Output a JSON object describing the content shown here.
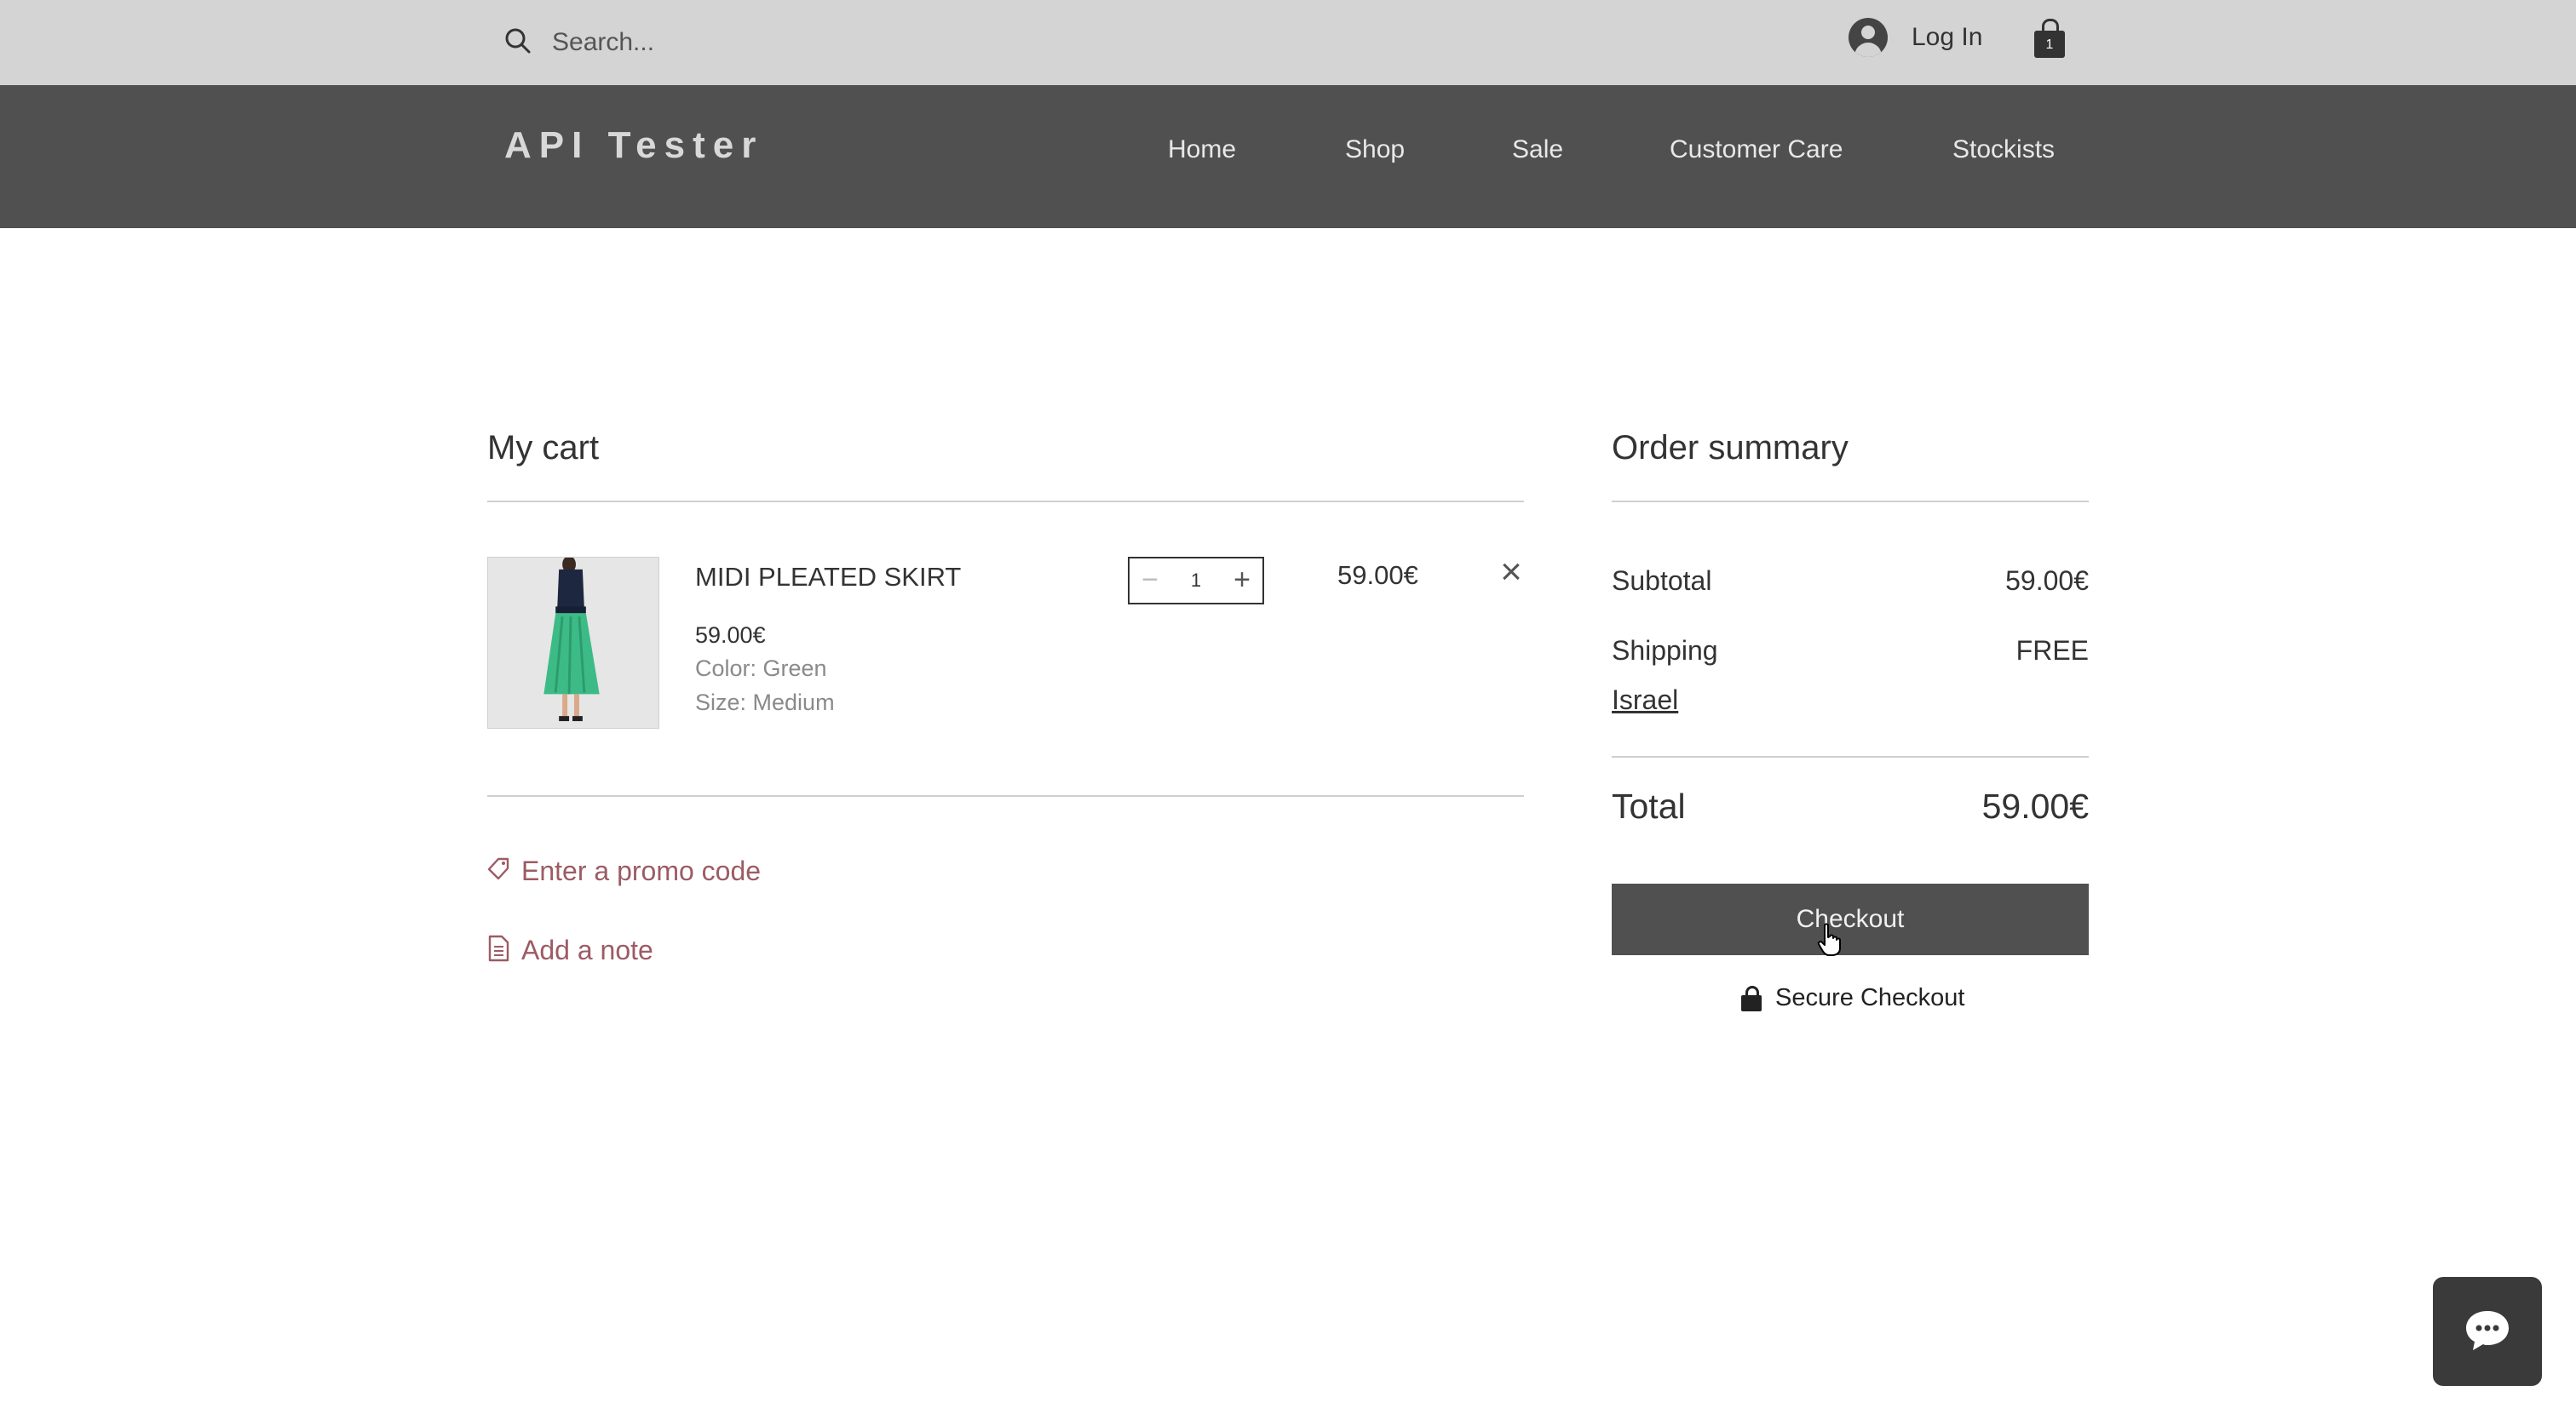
{
  "topbar": {
    "search_placeholder": "Search...",
    "login_label": "Log In",
    "cart_count": "1"
  },
  "header": {
    "brand": "API Tester",
    "nav": [
      {
        "label": "Home"
      },
      {
        "label": "Shop"
      },
      {
        "label": "Sale"
      },
      {
        "label": "Customer Care"
      },
      {
        "label": "Stockists"
      }
    ]
  },
  "cart": {
    "title": "My cart",
    "items": [
      {
        "name": "MIDI PLEATED SKIRT",
        "price": "59.00€",
        "color": "Color: Green",
        "size": "Size: Medium",
        "quantity": "1",
        "line_total": "59.00€"
      }
    ],
    "promo_label": "Enter a promo code",
    "note_label": "Add a note"
  },
  "summary": {
    "title": "Order summary",
    "subtotal_label": "Subtotal",
    "subtotal_value": "59.00€",
    "shipping_label": "Shipping",
    "shipping_value": "FREE",
    "shipping_country": "Israel",
    "total_label": "Total",
    "total_value": "59.00€",
    "checkout_label": "Checkout",
    "secure_label": "Secure Checkout"
  },
  "colors": {
    "topbar_bg": "#d4d4d4",
    "navbar_bg": "#505050",
    "accent_link": "#9d5b63",
    "checkout_bg": "#505050"
  },
  "icons": {
    "search": "search-icon",
    "user": "user-avatar-icon",
    "cart": "shopping-bag-icon",
    "remove": "close-icon",
    "promo": "tag-icon",
    "note": "note-icon",
    "lock": "lock-icon",
    "chat": "chat-icon"
  }
}
